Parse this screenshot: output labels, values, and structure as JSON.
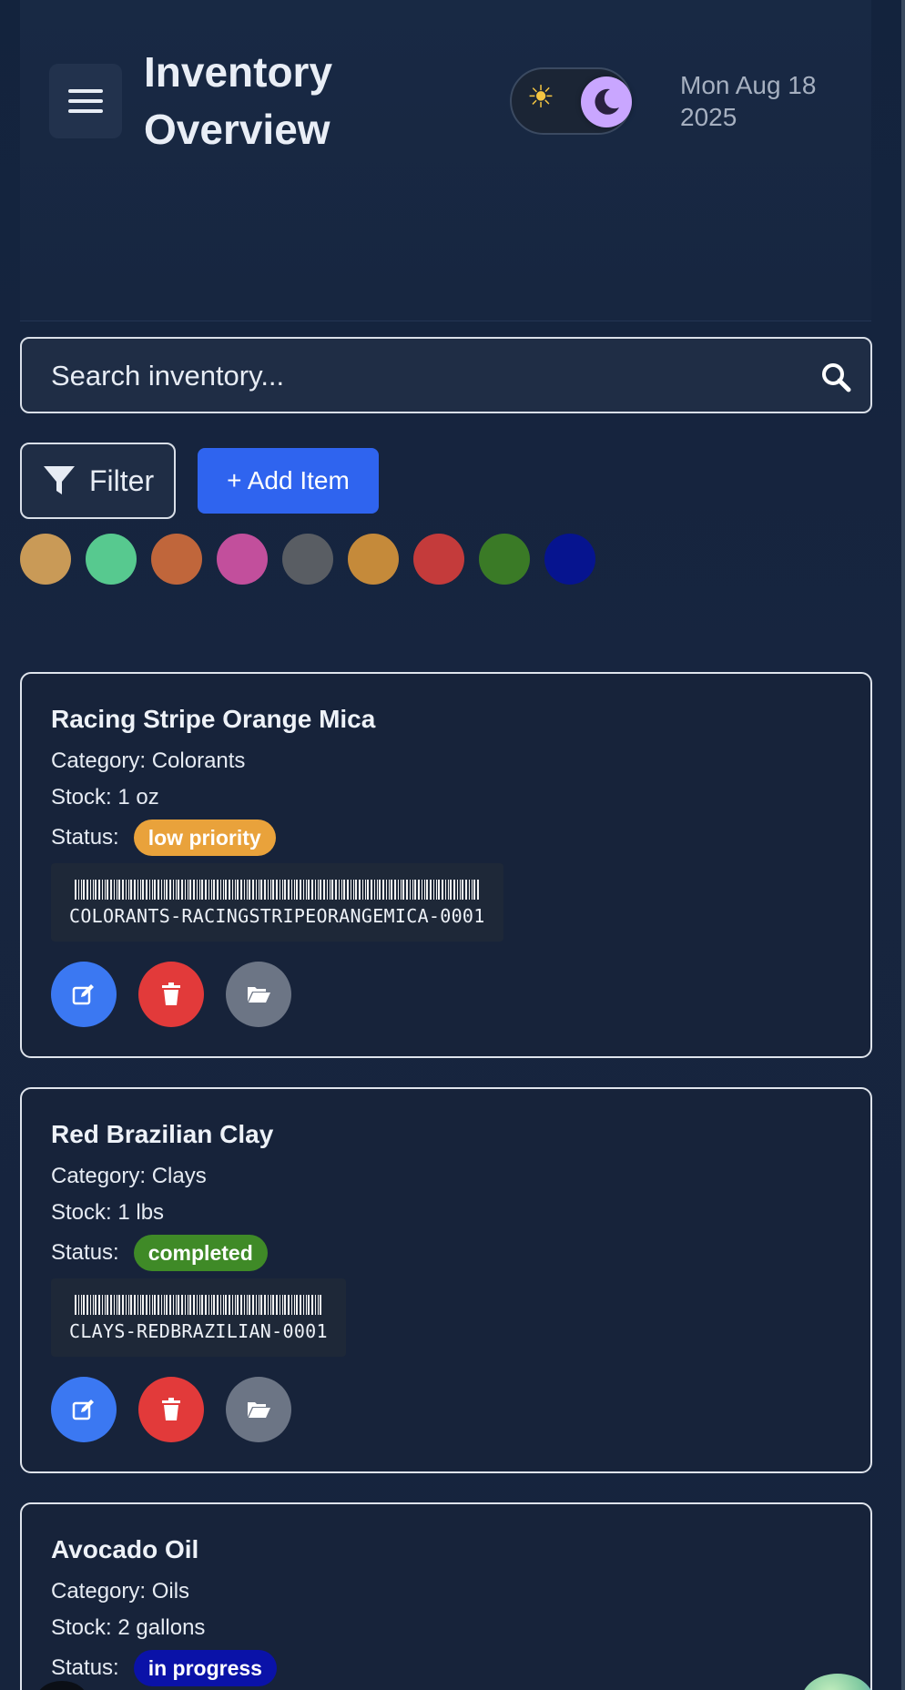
{
  "header": {
    "title": "Inventory Overview",
    "date": "Mon Aug 18 2025",
    "menu_icon": "hamburger-menu-icon",
    "theme_toggle": {
      "light_icon": "sun-icon",
      "dark_icon": "moon-icon",
      "mode": "dark"
    }
  },
  "search": {
    "placeholder": "Search inventory...",
    "icon": "search-icon"
  },
  "toolbar": {
    "filter_label": "Filter",
    "filter_icon": "funnel-icon",
    "add_label": "+ Add Item"
  },
  "swatches": [
    "#c99a57",
    "#57c98f",
    "#c0663b",
    "#c24f9c",
    "#595d63",
    "#c58a3a",
    "#c43b3b",
    "#3a7a26",
    "#06148f"
  ],
  "items": [
    {
      "name": "Racing Stripe Orange Mica",
      "category": "Category: Colorants",
      "stock": "Stock: 1 oz",
      "status_label": "Status:",
      "status": "low priority",
      "status_color": "#e9a23b",
      "barcode": "COLORANTS-RACINGSTRIPEORANGEMICA-0001"
    },
    {
      "name": "Red Brazilian Clay",
      "category": "Category: Clays",
      "stock": "Stock: 1 lbs",
      "status_label": "Status:",
      "status": "completed",
      "status_color": "#3f8a27",
      "barcode": "CLAYS-REDBRAZILIAN-0001"
    },
    {
      "name": "Avocado Oil",
      "category": "Category: Oils",
      "stock": "Stock: 2 gallons",
      "status_label": "Status:",
      "status": "in progress",
      "status_color": "#0a12a8"
    }
  ],
  "item_action_icons": [
    "edit-icon",
    "trash-icon",
    "folder-open-icon"
  ]
}
